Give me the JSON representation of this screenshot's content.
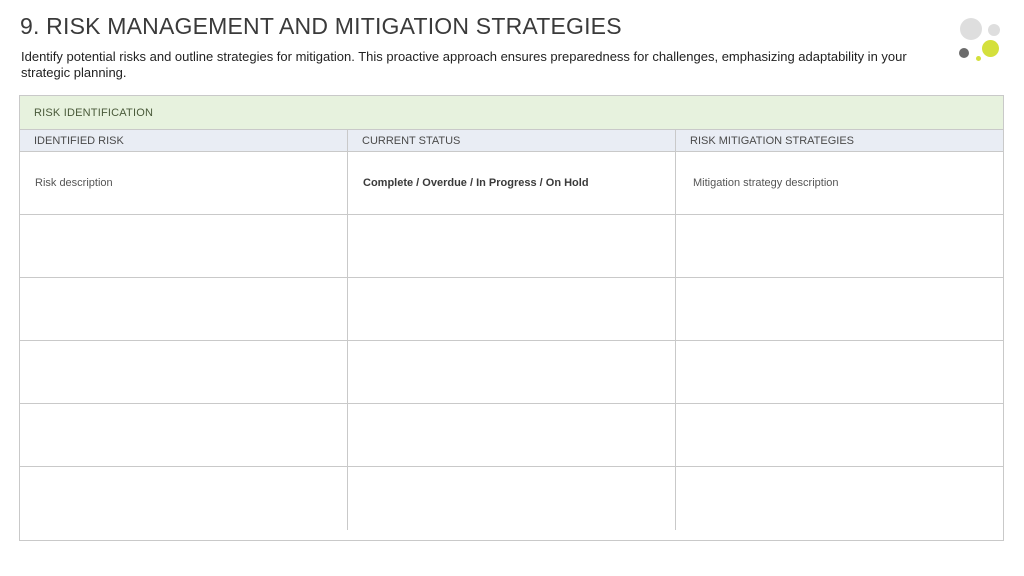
{
  "page": {
    "title": "9. RISK MANAGEMENT AND MITIGATION STRATEGIES",
    "subtitle": "Identify potential risks and outline strategies for mitigation. This proactive approach ensures preparedness for challenges, emphasizing adaptability in your strategic planning."
  },
  "colors": {
    "section_header_bg": "#e7f2de",
    "column_header_bg": "#e9edf4",
    "accent_yellow": "#d4e03c",
    "accent_gray": "#6b6b6b",
    "border": "#c9c9c9"
  },
  "table": {
    "section_label": "RISK IDENTIFICATION",
    "columns": [
      "IDENTIFIED RISK",
      "CURRENT STATUS",
      "RISK MITIGATION STRATEGIES"
    ],
    "rows": [
      [
        "Risk description",
        "Complete / Overdue / In Progress / On Hold",
        "Mitigation strategy description"
      ],
      [
        "",
        "",
        ""
      ],
      [
        "",
        "",
        ""
      ],
      [
        "",
        "",
        ""
      ],
      [
        "",
        "",
        ""
      ],
      [
        "",
        "",
        ""
      ]
    ]
  }
}
